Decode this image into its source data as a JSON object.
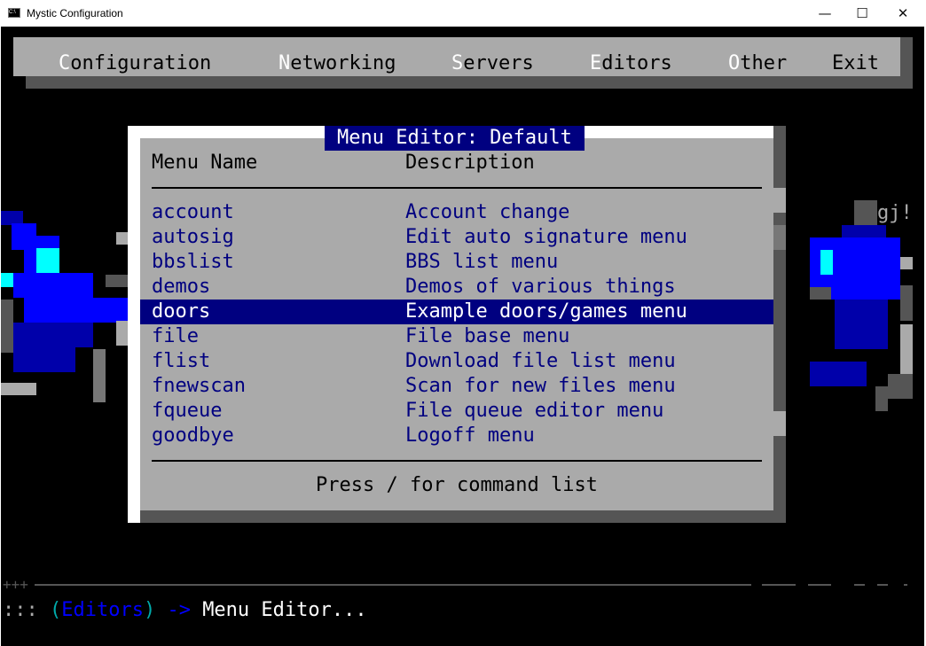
{
  "window": {
    "title": "Mystic Configuration",
    "icon_text": "C:\\",
    "minimize": "—",
    "maximize": "☐",
    "close": "✕"
  },
  "menubar": [
    {
      "hotkey": "C",
      "rest": "onfiguration"
    },
    {
      "hotkey": "N",
      "rest": "etworking"
    },
    {
      "hotkey": "S",
      "rest": "ervers"
    },
    {
      "hotkey": "E",
      "rest": "ditors"
    },
    {
      "hotkey": "O",
      "rest": "ther"
    },
    {
      "hotkey": "Ex",
      "rest": "it",
      "full": "Exit"
    }
  ],
  "dialog": {
    "title": "Menu Editor: Default",
    "columns": {
      "name": "Menu Name",
      "description": "Description"
    },
    "rows": [
      {
        "name": "account",
        "description": "Account change"
      },
      {
        "name": "autosig",
        "description": "Edit auto signature menu"
      },
      {
        "name": "bbslist",
        "description": "BBS list menu"
      },
      {
        "name": "demos",
        "description": "Demos of various things"
      },
      {
        "name": "doors",
        "description": "Example doors/games menu",
        "selected": true
      },
      {
        "name": "file",
        "description": "File base menu"
      },
      {
        "name": "flist",
        "description": "Download file list menu"
      },
      {
        "name": "fnewscan",
        "description": "Scan for new files menu"
      },
      {
        "name": "fqueue",
        "description": "File queue editor menu"
      },
      {
        "name": "goodbye",
        "description": "Logoff menu"
      }
    ],
    "footer": "Press / for command list"
  },
  "art_text": "gj!",
  "status": {
    "prefix": "::: ",
    "paren_open": "(",
    "section": "Editors",
    "paren_close": ")",
    "arrow": " -> ",
    "current": "Menu Editor..."
  },
  "statusline_marks": "+++",
  "colors": {
    "navy": "#000080",
    "gray": "#aaaaaa",
    "dark_gray": "#555555",
    "blue": "#0000ff",
    "cyan": "#00ffff"
  }
}
